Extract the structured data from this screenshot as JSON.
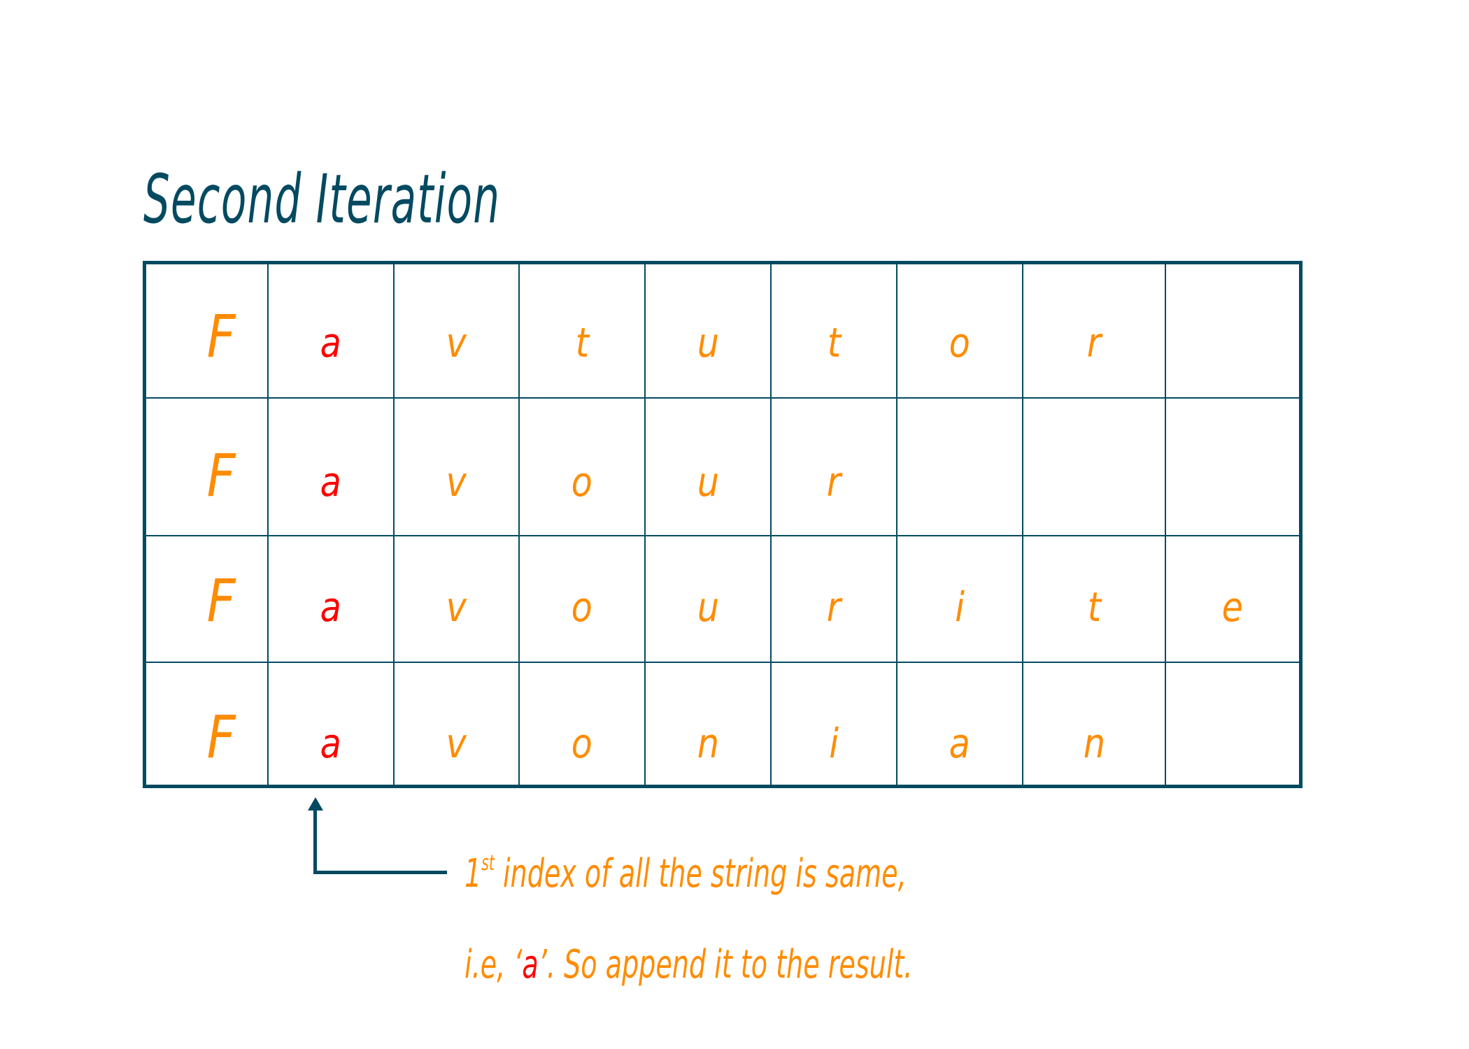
{
  "title": "Second Iteration",
  "colors": {
    "title": "#034A61",
    "grid": "#034A61",
    "letter": "#FF8C00",
    "highlight": "#FF0000"
  },
  "grid": {
    "highlight_column": 1,
    "rows": [
      {
        "word": "Favtutor",
        "letters": [
          "F",
          "a",
          "v",
          "t",
          "u",
          "t",
          "o",
          "r",
          ""
        ]
      },
      {
        "word": "Favour",
        "letters": [
          "F",
          "a",
          "v",
          "o",
          "u",
          "r",
          "",
          "",
          ""
        ]
      },
      {
        "word": "Favourite",
        "letters": [
          "F",
          "a",
          "v",
          "o",
          "u",
          "r",
          "i",
          "t",
          "e"
        ]
      },
      {
        "word": "Favonian",
        "letters": [
          "F",
          "a",
          "v",
          "o",
          "n",
          "i",
          "a",
          "n",
          ""
        ]
      }
    ]
  },
  "annotation": {
    "arrow_icon": "elbow-arrow-up-icon",
    "line1": {
      "number": "1",
      "superscript": "st",
      "rest": " index of all the string is same,"
    },
    "line2": {
      "prefix": "i.e, ‘",
      "highlight": "a",
      "suffix": "’. So append it to the result."
    }
  }
}
